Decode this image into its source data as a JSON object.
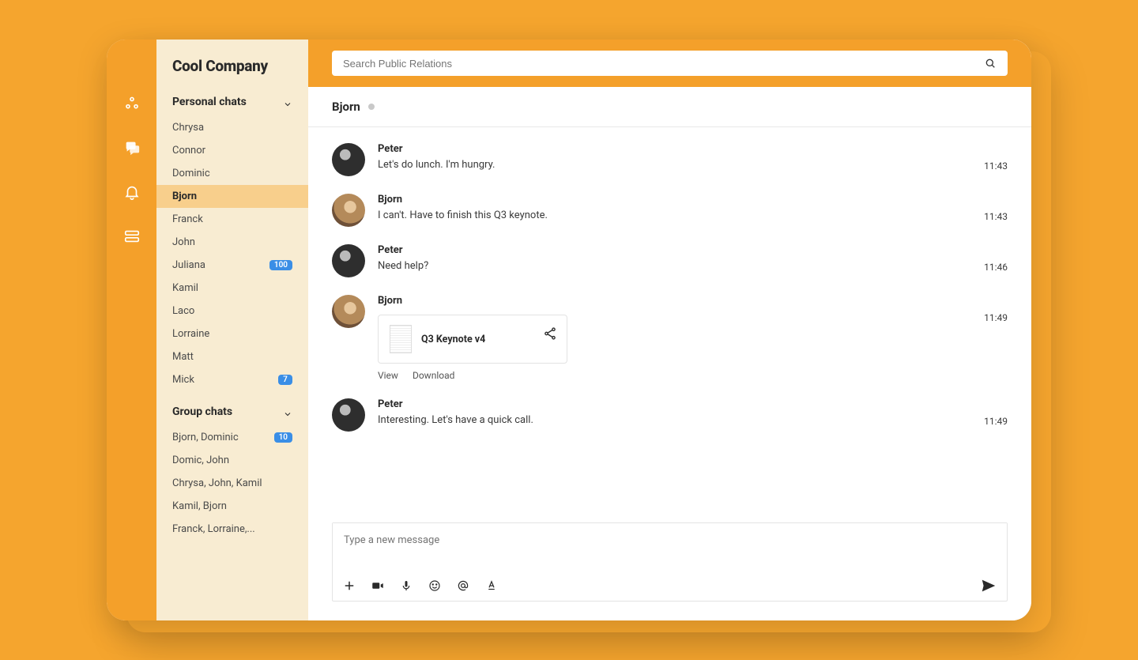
{
  "brand": "Cool Company",
  "search": {
    "placeholder": "Search Public Relations"
  },
  "sidebar": {
    "personal": {
      "title": "Personal chats",
      "items": [
        {
          "label": "Chrysa",
          "badge": null,
          "active": false
        },
        {
          "label": "Connor",
          "badge": null,
          "active": false
        },
        {
          "label": "Dominic",
          "badge": null,
          "active": false
        },
        {
          "label": "Bjorn",
          "badge": null,
          "active": true
        },
        {
          "label": "Franck",
          "badge": null,
          "active": false
        },
        {
          "label": "John",
          "badge": null,
          "active": false
        },
        {
          "label": "Juliana",
          "badge": "100",
          "active": false
        },
        {
          "label": "Kamil",
          "badge": null,
          "active": false
        },
        {
          "label": "Laco",
          "badge": null,
          "active": false
        },
        {
          "label": "Lorraine",
          "badge": null,
          "active": false
        },
        {
          "label": "Matt",
          "badge": null,
          "active": false
        },
        {
          "label": "Mick",
          "badge": "7",
          "active": false
        }
      ]
    },
    "group": {
      "title": "Group chats",
      "items": [
        {
          "label": "Bjorn, Dominic",
          "badge": "10",
          "active": false
        },
        {
          "label": "Domic, John",
          "badge": null,
          "active": false
        },
        {
          "label": "Chrysa, John, Kamil",
          "badge": null,
          "active": false
        },
        {
          "label": "Kamil, Bjorn",
          "badge": null,
          "active": false
        },
        {
          "label": "Franck, Lorraine,...",
          "badge": null,
          "active": false
        }
      ]
    }
  },
  "conversation": {
    "title": "Bjorn",
    "messages": [
      {
        "sender": "Peter",
        "avatar": "dark",
        "text": "Let's do lunch. I'm hungry.",
        "time": "11:43"
      },
      {
        "sender": "Bjorn",
        "avatar": "light",
        "text": "I can't. Have to finish this Q3 keynote.",
        "time": "11:43"
      },
      {
        "sender": "Peter",
        "avatar": "dark",
        "text": "Need help?",
        "time": "11:46"
      },
      {
        "sender": "Bjorn",
        "avatar": "light",
        "text": "",
        "time": "11:49",
        "file": {
          "name": "Q3 Keynote v4",
          "view": "View",
          "download": "Download"
        }
      },
      {
        "sender": "Peter",
        "avatar": "dark",
        "text": "Interesting. Let's have a quick call.",
        "time": "11:49"
      }
    ]
  },
  "composer": {
    "placeholder": "Type a new message"
  }
}
